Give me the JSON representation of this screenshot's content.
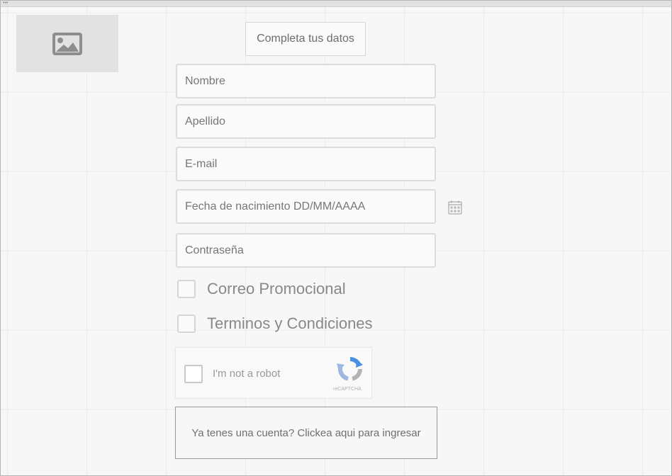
{
  "header": {
    "image_icon": "image-placeholder-icon",
    "title": "Completa tus datos"
  },
  "form": {
    "fields": [
      {
        "placeholder": "Nombre"
      },
      {
        "placeholder": "Apellido"
      },
      {
        "placeholder": "E-mail"
      },
      {
        "placeholder": "Fecha de nacimiento DD/MM/AAAA",
        "icon": "calendar-icon"
      },
      {
        "placeholder": "Contraseña"
      }
    ],
    "checkboxes": [
      {
        "label": "Correo Promocional",
        "checked": false
      },
      {
        "label": "Terminos y Condiciones",
        "checked": false
      }
    ],
    "recaptcha": {
      "label": "I'm not a robot",
      "brand": "reCAPTCHA"
    },
    "login_link": "Ya tenes una cuenta? Clickea aqui para ingresar"
  },
  "colors": {
    "background": "#f7f7f7",
    "field_border": "#dcdcdc",
    "text_muted": "#777777",
    "recaptcha_blue": "#4a90e2"
  }
}
